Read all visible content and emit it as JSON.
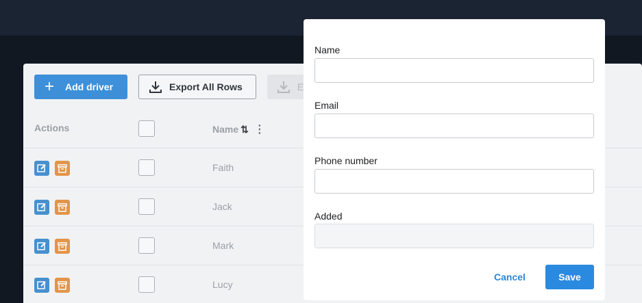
{
  "toolbar": {
    "add_label": "Add driver",
    "export_label": "Export All Rows",
    "disabled_label": "E"
  },
  "table": {
    "headers": {
      "actions": "Actions",
      "name": "Name"
    },
    "rows": [
      {
        "name": "Faith"
      },
      {
        "name": "Jack"
      },
      {
        "name": "Mark"
      },
      {
        "name": "Lucy"
      }
    ]
  },
  "modal": {
    "fields": [
      {
        "label": "Name",
        "value": ""
      },
      {
        "label": "Email",
        "value": ""
      },
      {
        "label": "Phone number",
        "value": ""
      },
      {
        "label": "Added",
        "value": ""
      }
    ],
    "cancel_label": "Cancel",
    "save_label": "Save"
  },
  "colors": {
    "primary": "#2a86d6",
    "archive": "#e0852d",
    "overlay": "#0f1723"
  }
}
